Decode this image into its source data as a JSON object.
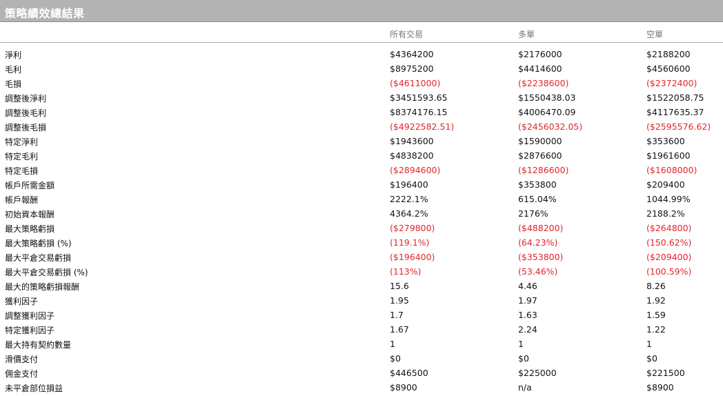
{
  "title": "策略績效總結果",
  "headers": {
    "all": "所有交易",
    "long": "多單",
    "short": "空單"
  },
  "rows": [
    {
      "label": "淨利",
      "all": "$4364200",
      "long": "$2176000",
      "short": "$2188200"
    },
    {
      "label": "毛利",
      "all": "$8975200",
      "long": "$4414600",
      "short": "$4560600"
    },
    {
      "label": "毛損",
      "all": "($4611000)",
      "long": "($2238600)",
      "short": "($2372400)"
    },
    {
      "label": "調整後淨利",
      "all": "$3451593.65",
      "long": "$1550438.03",
      "short": "$1522058.75"
    },
    {
      "label": "調整後毛利",
      "all": "$8374176.15",
      "long": "$4006470.09",
      "short": "$4117635.37"
    },
    {
      "label": "調整後毛損",
      "all": "($4922582.51)",
      "long": "($2456032.05)",
      "short": "($2595576.62)"
    },
    {
      "label": "特定淨利",
      "all": "$1943600",
      "long": "$1590000",
      "short": "$353600"
    },
    {
      "label": "特定毛利",
      "all": "$4838200",
      "long": "$2876600",
      "short": "$1961600"
    },
    {
      "label": "特定毛損",
      "all": "($2894600)",
      "long": "($1286600)",
      "short": "($1608000)"
    },
    {
      "label": "帳戶所需金額",
      "all": "$196400",
      "long": "$353800",
      "short": "$209400"
    },
    {
      "label": "帳戶報酬",
      "all": "2222.1%",
      "long": "615.04%",
      "short": "1044.99%"
    },
    {
      "label": "初始資本報酬",
      "all": "4364.2%",
      "long": "2176%",
      "short": "2188.2%"
    },
    {
      "label": "最大策略虧損",
      "all": "($279800)",
      "long": "($488200)",
      "short": "($264800)"
    },
    {
      "label": "最大策略虧損 (%)",
      "all": "(119.1%)",
      "long": "(64.23%)",
      "short": "(150.62%)"
    },
    {
      "label": "最大平倉交易虧損",
      "all": "($196400)",
      "long": "($353800)",
      "short": "($209400)"
    },
    {
      "label": "最大平倉交易虧損 (%)",
      "all": "(113%)",
      "long": "(53.46%)",
      "short": "(100.59%)"
    },
    {
      "label": "最大的策略虧損報酬",
      "all": "15.6",
      "long": "4.46",
      "short": "8.26"
    },
    {
      "label": "獲利因子",
      "all": "1.95",
      "long": "1.97",
      "short": "1.92"
    },
    {
      "label": "調整獲利因子",
      "all": "1.7",
      "long": "1.63",
      "short": "1.59"
    },
    {
      "label": "特定獲利因子",
      "all": "1.67",
      "long": "2.24",
      "short": "1.22"
    },
    {
      "label": "最大持有契約數量",
      "all": "1",
      "long": "1",
      "short": "1"
    },
    {
      "label": "滑價支付",
      "all": "$0",
      "long": "$0",
      "short": "$0"
    },
    {
      "label": "佣金支付",
      "all": "$446500",
      "long": "$225000",
      "short": "$221500"
    },
    {
      "label": "未平倉部位損益",
      "all": "$8900",
      "long": "n/a",
      "short": "$8900"
    }
  ],
  "colors": {
    "title_bar": "#b3b3b3",
    "negative": "#e0262b",
    "header_text": "#777777"
  }
}
